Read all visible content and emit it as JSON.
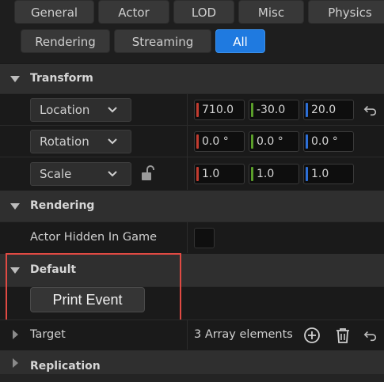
{
  "filters": {
    "row1": [
      "General",
      "Actor",
      "LOD",
      "Misc",
      "Physics"
    ],
    "row2": [
      "Rendering",
      "Streaming",
      "All"
    ],
    "active": "All"
  },
  "transform": {
    "header": "Transform",
    "location": {
      "mode": "Location",
      "x": "710.0",
      "y": "-30.0",
      "z": "20.0"
    },
    "rotation": {
      "mode": "Rotation",
      "x": "0.0 °",
      "y": "0.0 °",
      "z": "0.0 °"
    },
    "scale": {
      "mode": "Scale",
      "x": "1.0",
      "y": "1.0",
      "z": "1.0",
      "lock_icon": "unlock-icon"
    }
  },
  "rendering": {
    "header": "Rendering",
    "actor_hidden_label": "Actor Hidden In Game",
    "actor_hidden_checked": false
  },
  "default": {
    "header": "Default",
    "print_event_label": "Print Event"
  },
  "target": {
    "label": "Target",
    "value": "3 Array elements",
    "icons": [
      "add-element-icon",
      "delete-icon",
      "reset-icon"
    ]
  },
  "replication": {
    "header": "Replication"
  },
  "colors": {
    "x_axis": "#c23b2f",
    "y_axis": "#5a9e2a",
    "z_axis": "#2d6fd6",
    "active_tab": "#1f7ae0",
    "highlight": "#e04a43"
  }
}
